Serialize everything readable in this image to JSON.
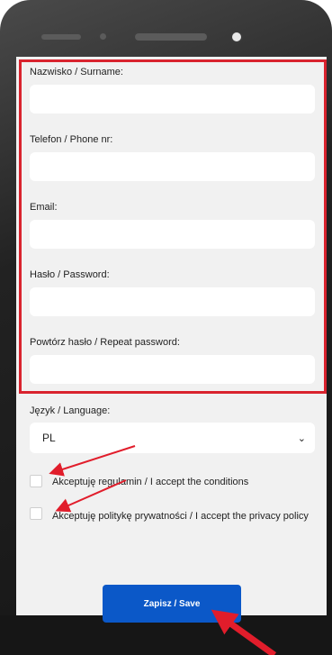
{
  "form": {
    "surname_label": "Nazwisko / Surname:",
    "phone_label": "Telefon / Phone nr:",
    "email_label": "Email:",
    "password_label": "Hasło / Password:",
    "repeat_password_label": "Powtórz hasło / Repeat password:",
    "language_label": "Język / Language:",
    "language_value": "PL",
    "terms_label": "Akceptuję regulamin / I accept the conditions",
    "privacy_label": "Akceptuję politykę prywatności / I accept the privacy policy",
    "save_label": "Zapisz / Save"
  },
  "colors": {
    "highlight": "#d9232e",
    "button": "#0b58c8",
    "screen_bg": "#f1f1f1"
  },
  "icons": {
    "select_arrow": "chevron-down-icon",
    "annotation_arrows": "arrow-icon"
  }
}
